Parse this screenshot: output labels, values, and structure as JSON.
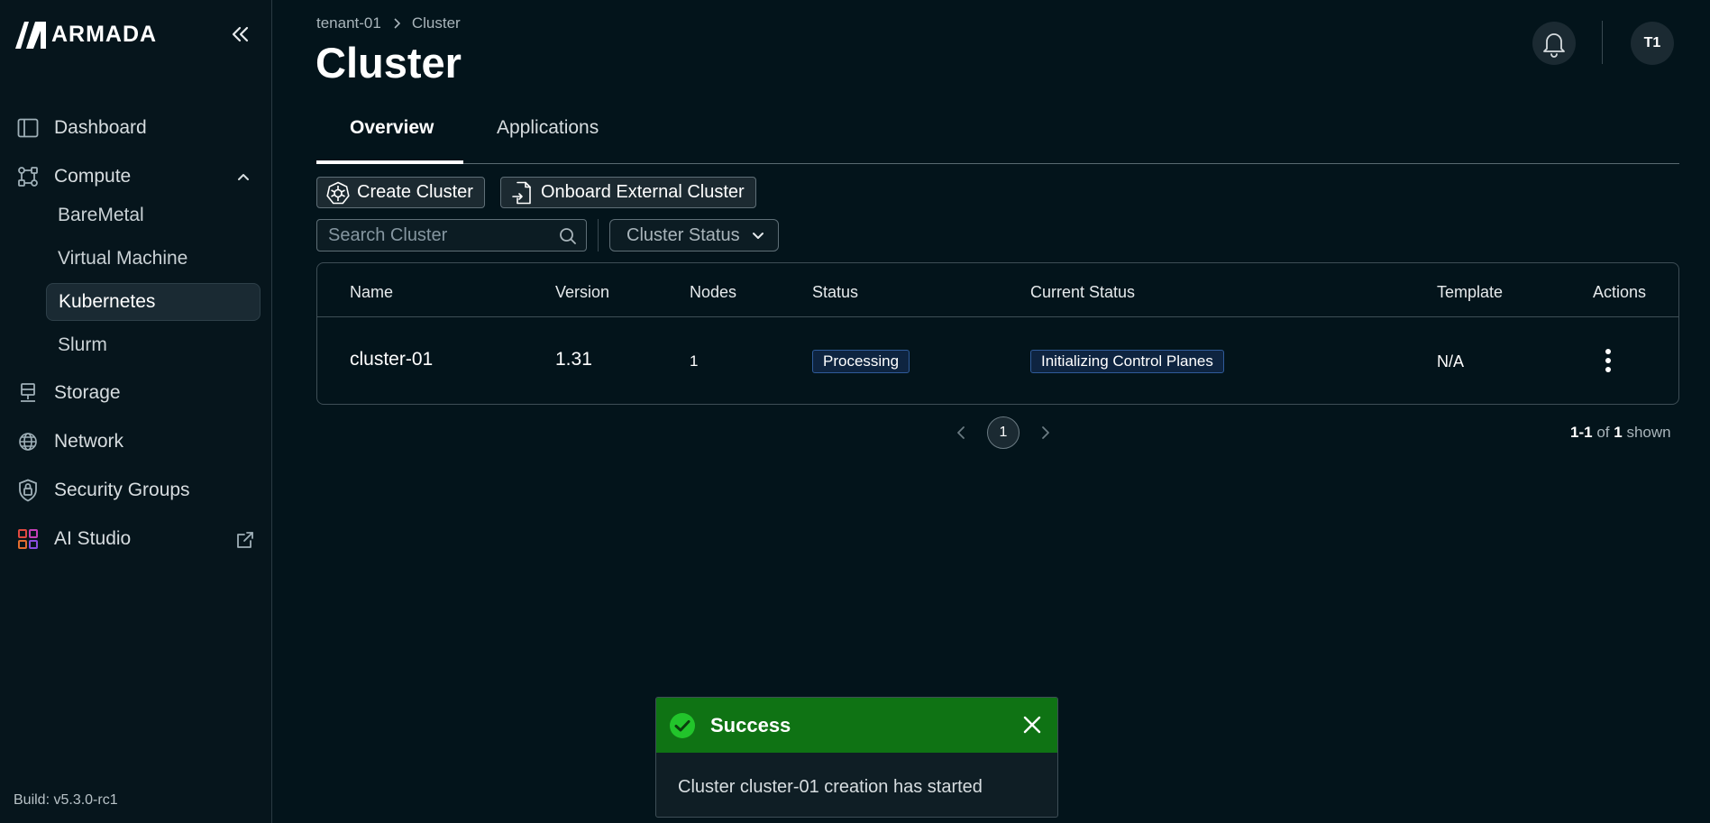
{
  "brand": {
    "name": "ARMADA"
  },
  "sidebar": {
    "items": [
      {
        "label": "Dashboard",
        "icon": "panel-left-icon"
      },
      {
        "label": "Compute",
        "icon": "compute-nodes-icon"
      },
      {
        "label": "BareMetal"
      },
      {
        "label": "Virtual Machine"
      },
      {
        "label": "Kubernetes"
      },
      {
        "label": "Slurm"
      },
      {
        "label": "Storage",
        "icon": "storage-icon"
      },
      {
        "label": "Network",
        "icon": "globe-icon"
      },
      {
        "label": "Security Groups",
        "icon": "shield-lock-icon"
      },
      {
        "label": "AI Studio",
        "icon": "grid-apps-icon"
      }
    ],
    "active_item": "Kubernetes",
    "build": "Build: v5.3.0-rc1"
  },
  "header": {
    "breadcrumb": [
      "tenant-01",
      "Cluster"
    ],
    "title": "Cluster",
    "avatar_initials": "T1"
  },
  "tabs": [
    {
      "label": "Overview",
      "active": true
    },
    {
      "label": "Applications",
      "active": false
    }
  ],
  "toolbar": {
    "create_label": "Create Cluster",
    "onboard_label": "Onboard External Cluster",
    "search_placeholder": "Search Cluster",
    "status_filter_label": "Cluster Status"
  },
  "table": {
    "columns": [
      "Name",
      "Version",
      "Nodes",
      "Status",
      "Current Status",
      "Template",
      "Actions"
    ],
    "rows": [
      {
        "name": "cluster-01",
        "version": "1.31",
        "nodes": "1",
        "status": "Processing",
        "current_status": "Initializing Control Planes",
        "template": "N/A"
      }
    ]
  },
  "pagination": {
    "current_page": "1",
    "range": "1-1",
    "of_label": "of",
    "total": "1",
    "shown_label": "shown"
  },
  "toast": {
    "title": "Success",
    "message": "Cluster cluster-01 creation has started",
    "color": "#0f7314"
  },
  "colors": {
    "background": "#03141b",
    "badge_border": "#2f5b9a",
    "success": "#0f7314"
  }
}
